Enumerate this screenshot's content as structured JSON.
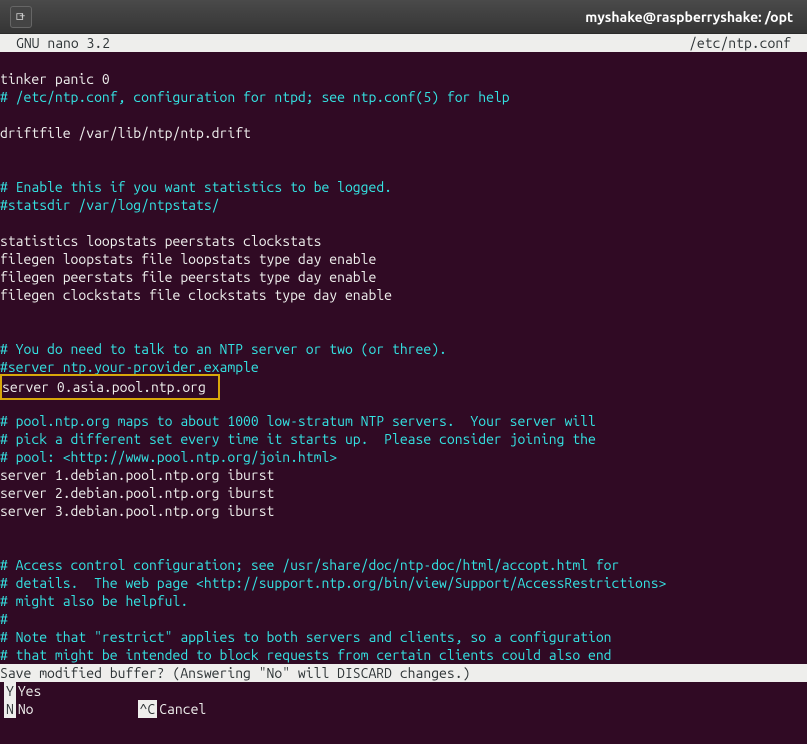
{
  "titlebar": {
    "title": "myshake@raspberryshake: /opt"
  },
  "header": {
    "appname": "GNU nano 3.2",
    "filename": "/etc/ntp.conf"
  },
  "content": {
    "lines": [
      {
        "type": "blank",
        "text": ""
      },
      {
        "type": "plain",
        "text": "tinker panic 0"
      },
      {
        "type": "comment",
        "text": "# /etc/ntp.conf, configuration for ntpd; see ntp.conf(5) for help"
      },
      {
        "type": "blank",
        "text": ""
      },
      {
        "type": "plain",
        "text": "driftfile /var/lib/ntp/ntp.drift"
      },
      {
        "type": "blank",
        "text": ""
      },
      {
        "type": "blank",
        "text": ""
      },
      {
        "type": "comment",
        "text": "# Enable this if you want statistics to be logged."
      },
      {
        "type": "comment",
        "text": "#statsdir /var/log/ntpstats/"
      },
      {
        "type": "blank",
        "text": ""
      },
      {
        "type": "plain",
        "text": "statistics loopstats peerstats clockstats"
      },
      {
        "type": "plain",
        "text": "filegen loopstats file loopstats type day enable"
      },
      {
        "type": "plain",
        "text": "filegen peerstats file peerstats type day enable"
      },
      {
        "type": "plain",
        "text": "filegen clockstats file clockstats type day enable"
      },
      {
        "type": "blank",
        "text": ""
      },
      {
        "type": "blank",
        "text": ""
      },
      {
        "type": "comment",
        "text": "# You do need to talk to an NTP server or two (or three)."
      },
      {
        "type": "comment",
        "text": "#server ntp.your-provider.example"
      },
      {
        "type": "highlighted",
        "text": "server 0.asia.pool.ntp.org"
      },
      {
        "type": "blank",
        "text": ""
      },
      {
        "type": "comment",
        "text": "# pool.ntp.org maps to about 1000 low-stratum NTP servers.  Your server will"
      },
      {
        "type": "comment",
        "text": "# pick a different set every time it starts up.  Please consider joining the"
      },
      {
        "type": "comment",
        "text": "# pool: <http://www.pool.ntp.org/join.html>"
      },
      {
        "type": "plain",
        "text": "server 1.debian.pool.ntp.org iburst"
      },
      {
        "type": "plain",
        "text": "server 2.debian.pool.ntp.org iburst"
      },
      {
        "type": "plain",
        "text": "server 3.debian.pool.ntp.org iburst"
      },
      {
        "type": "blank",
        "text": ""
      },
      {
        "type": "blank",
        "text": ""
      },
      {
        "type": "comment",
        "text": "# Access control configuration; see /usr/share/doc/ntp-doc/html/accopt.html for"
      },
      {
        "type": "comment",
        "text": "# details.  The web page <http://support.ntp.org/bin/view/Support/AccessRestrictions>"
      },
      {
        "type": "comment",
        "text": "# might also be helpful."
      },
      {
        "type": "comment",
        "text": "#"
      },
      {
        "type": "comment",
        "text": "# Note that \"restrict\" applies to both servers and clients, so a configuration"
      },
      {
        "type": "comment",
        "text": "# that might be intended to block requests from certain clients could also end"
      }
    ]
  },
  "prompt": {
    "text": "Save modified buffer?  (Answering \"No\" will DISCARD changes.) "
  },
  "shortcuts": {
    "yes": {
      "key": " Y",
      "label": "Yes"
    },
    "no": {
      "key": " N",
      "label": "No"
    },
    "cancel": {
      "key": "^C",
      "label": "Cancel"
    }
  }
}
